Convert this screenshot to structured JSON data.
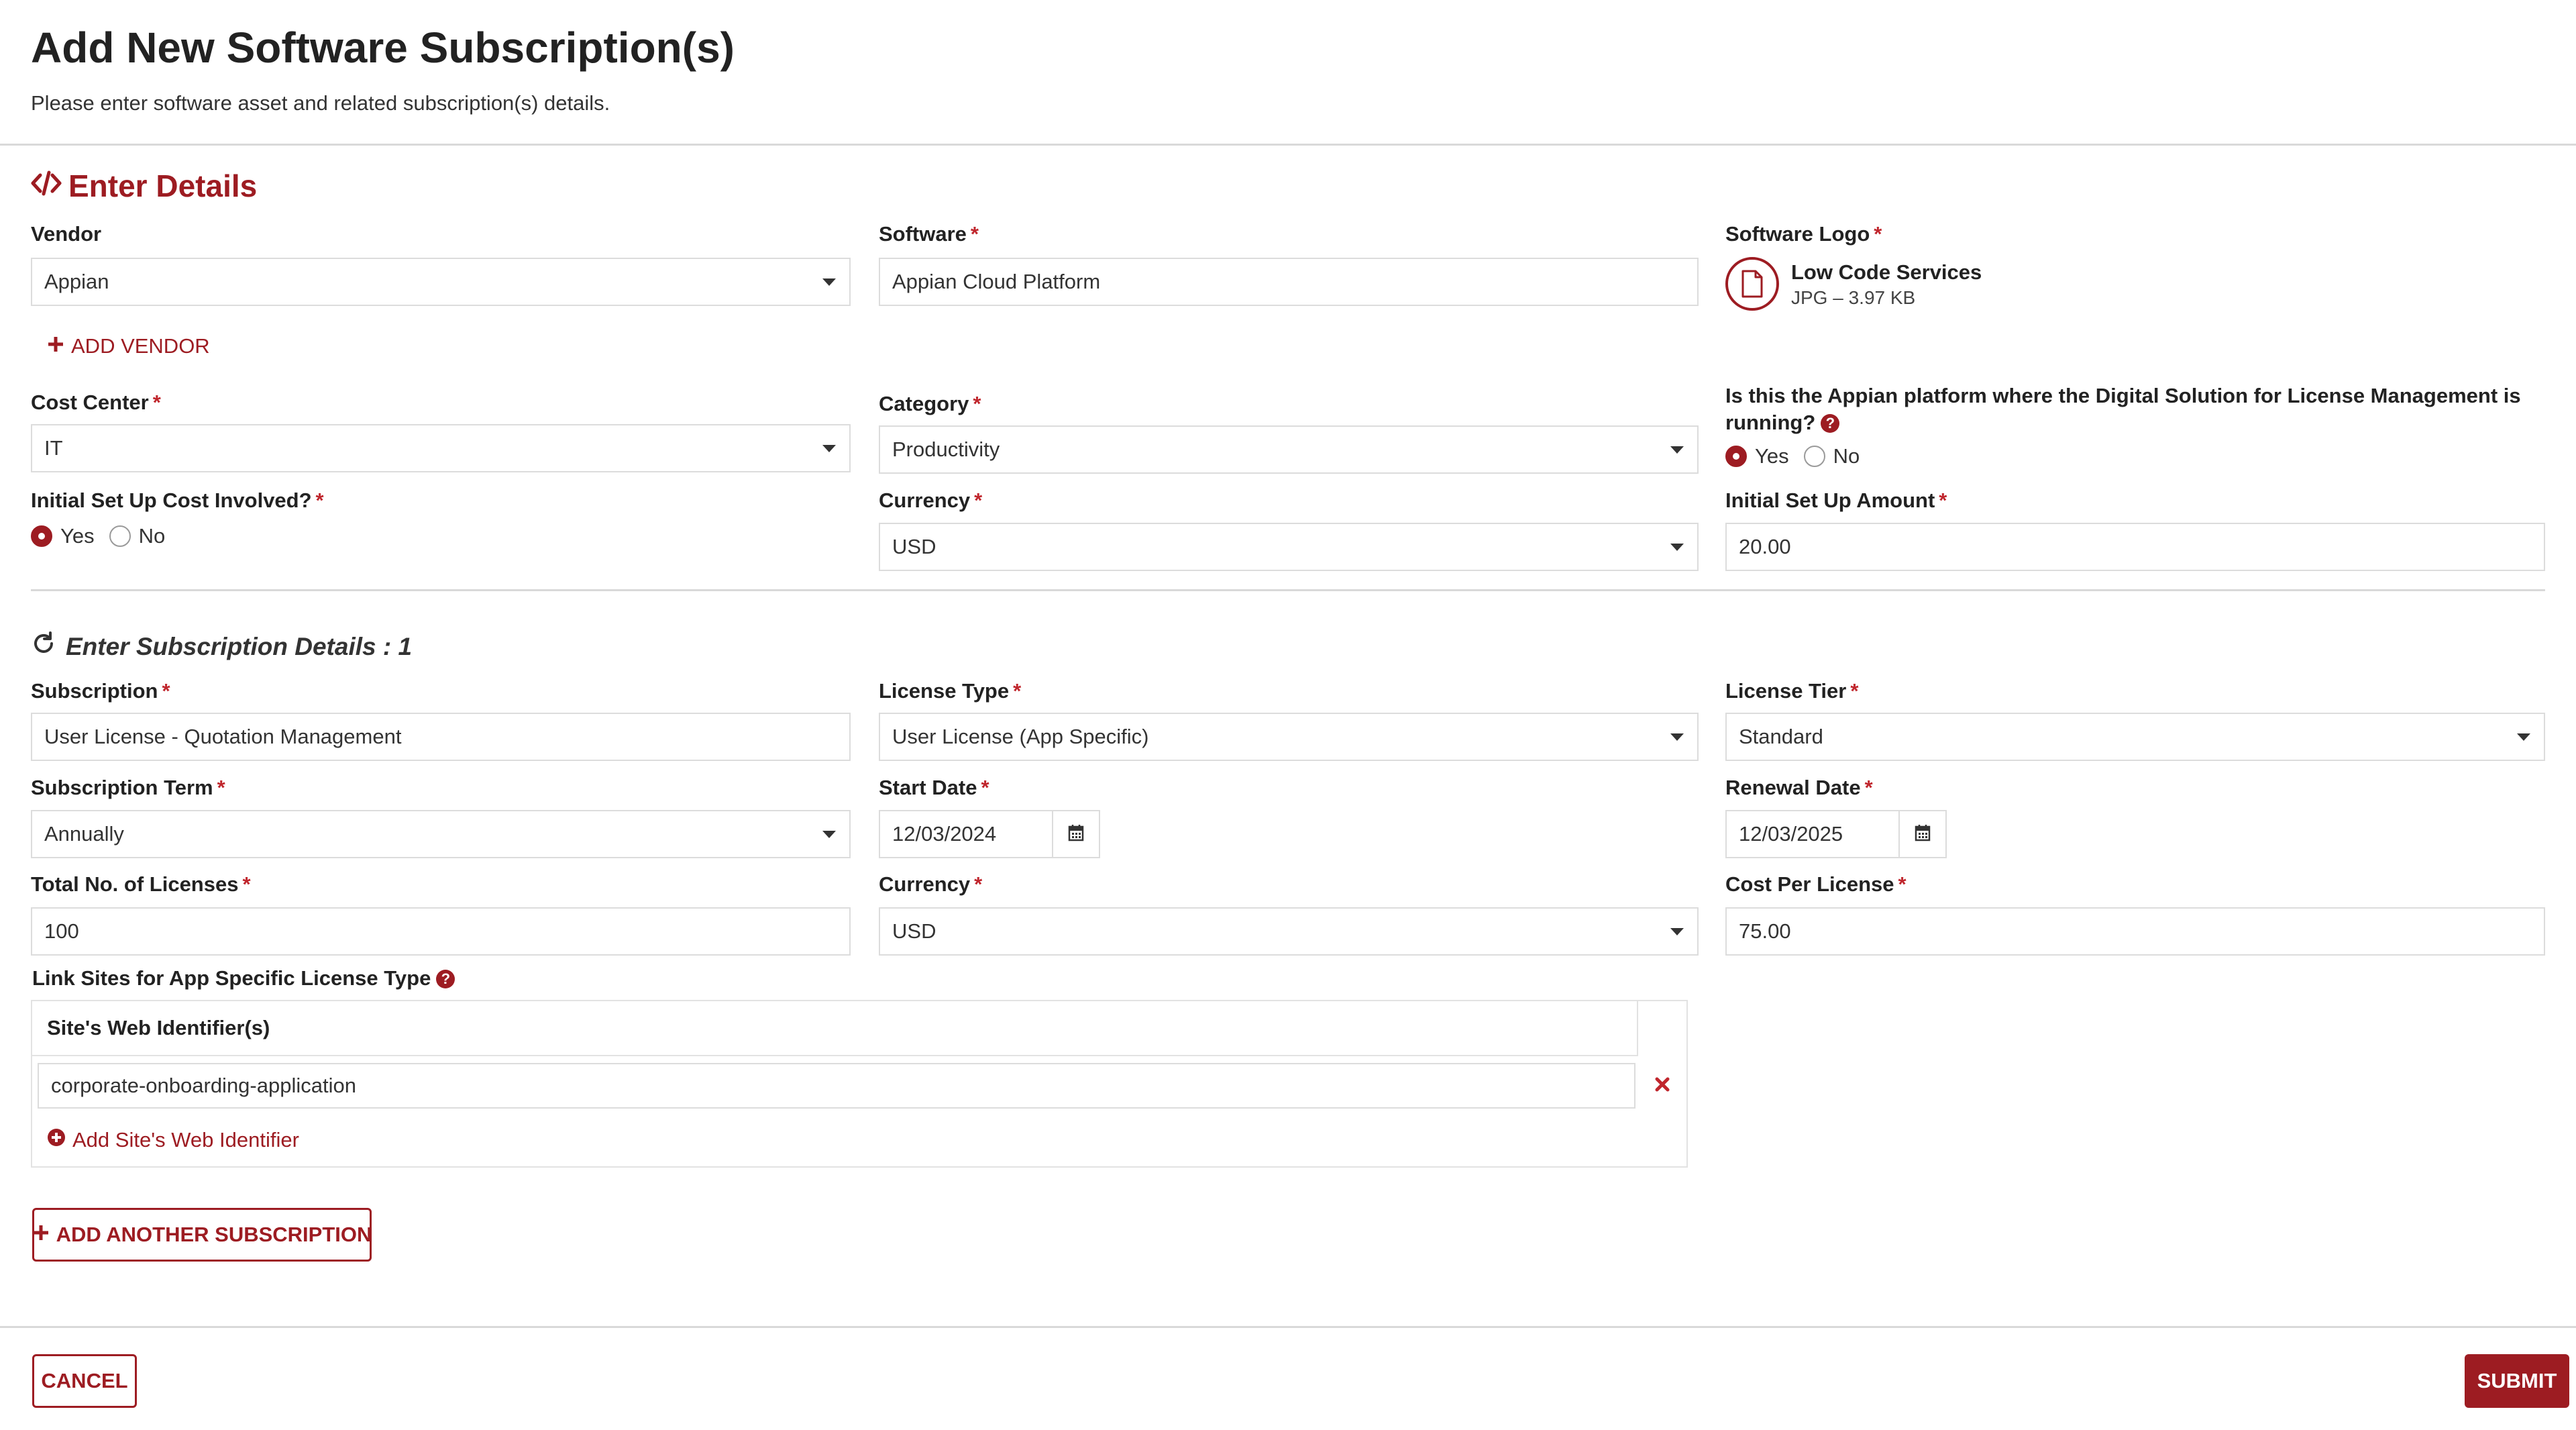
{
  "page": {
    "title": "Add New Software Subscription(s)",
    "subtitle": "Please enter software asset and related subscription(s) details."
  },
  "details": {
    "heading": "Enter Details",
    "vendor": {
      "label": "Vendor",
      "value": "Appian"
    },
    "add_vendor": "ADD VENDOR",
    "software": {
      "label": "Software",
      "value": "Appian Cloud Platform"
    },
    "software_logo": {
      "label": "Software Logo",
      "file_name": "Low Code Services",
      "file_meta": "JPG – 3.97 KB"
    },
    "cost_center": {
      "label": "Cost Center",
      "value": "IT"
    },
    "category": {
      "label": "Category",
      "value": "Productivity"
    },
    "platform_question": {
      "label": "Is this the Appian platform where the Digital Solution for License Management is running?",
      "options": [
        "Yes",
        "No"
      ],
      "selected": "Yes"
    },
    "initial_cost_involved": {
      "label": "Initial Set Up Cost Involved?",
      "options": [
        "Yes",
        "No"
      ],
      "selected": "Yes"
    },
    "currency": {
      "label": "Currency",
      "value": "USD"
    },
    "initial_amount": {
      "label": "Initial Set Up Amount",
      "value": "20.00"
    }
  },
  "subscription": {
    "heading": "Enter Subscription Details : 1",
    "subscription": {
      "label": "Subscription",
      "value": "User License - Quotation Management"
    },
    "license_type": {
      "label": "License Type",
      "value": "User License (App Specific)"
    },
    "license_tier": {
      "label": "License Tier",
      "value": "Standard"
    },
    "term": {
      "label": "Subscription Term",
      "value": "Annually"
    },
    "start_date": {
      "label": "Start Date",
      "value": "12/03/2024"
    },
    "renewal_date": {
      "label": "Renewal Date",
      "value": "12/03/2025"
    },
    "total_licenses": {
      "label": "Total No. of Licenses",
      "value": "100"
    },
    "currency": {
      "label": "Currency",
      "value": "USD"
    },
    "cost_per_license": {
      "label": "Cost Per License",
      "value": "75.00"
    },
    "link_sites": {
      "label": "Link Sites for App Specific License Type",
      "column_header": "Site's Web Identifier(s)",
      "rows": [
        "corporate-onboarding-application"
      ],
      "add_label": "Add Site's Web Identifier"
    }
  },
  "actions": {
    "add_another": "ADD ANOTHER SUBSCRIPTION",
    "cancel": "CANCEL",
    "submit": "SUBMIT"
  },
  "required_mark": "*",
  "help_mark": "?",
  "colors": {
    "accent": "#9d1c22",
    "required": "#c0262d",
    "border": "#dcdcdc"
  },
  "icons": [
    "code-icon",
    "plus-icon",
    "file-icon",
    "help-icon",
    "refresh-icon",
    "calendar-icon",
    "close-icon",
    "plus-circle-icon",
    "caret-down-icon"
  ]
}
